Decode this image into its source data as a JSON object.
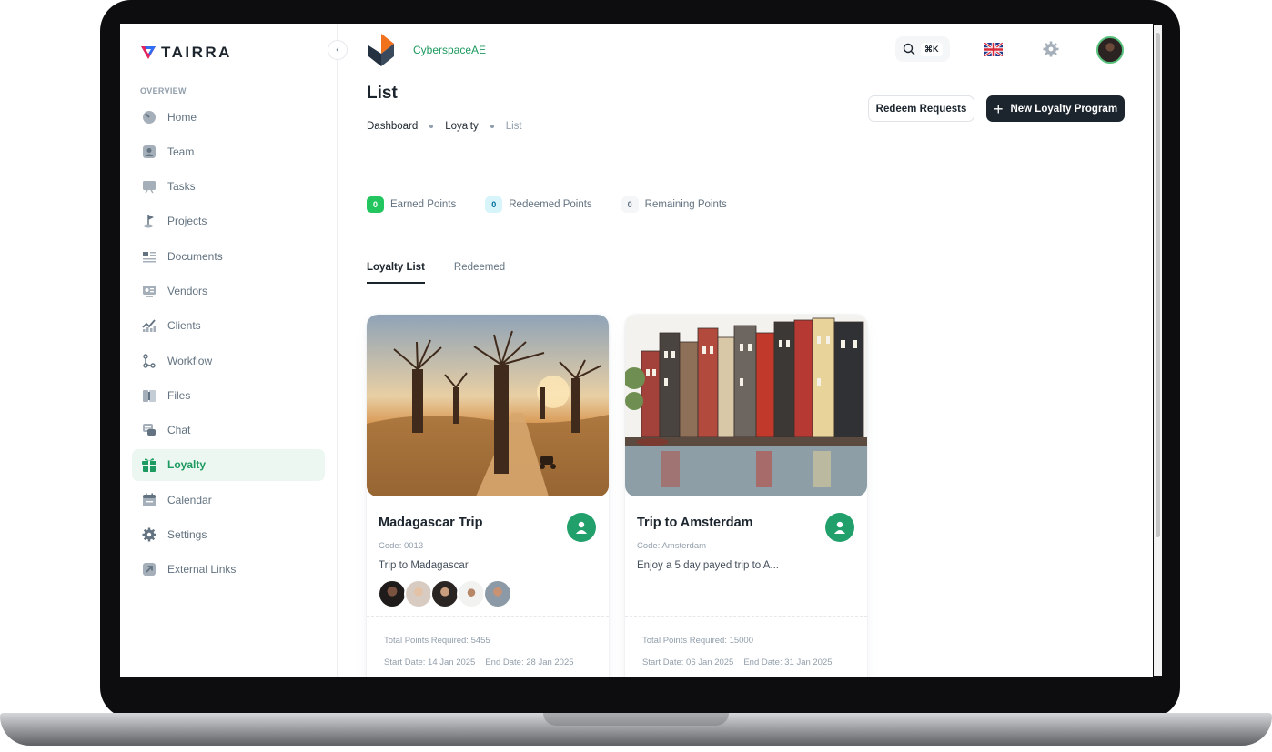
{
  "brand": {
    "name": "TAIRRA"
  },
  "sidebar": {
    "section_title": "OVERVIEW",
    "items": [
      {
        "label": "Home",
        "icon": "dashboard-gauge-icon"
      },
      {
        "label": "Team",
        "icon": "user-badge-icon"
      },
      {
        "label": "Tasks",
        "icon": "board-icon"
      },
      {
        "label": "Projects",
        "icon": "flag-icon"
      },
      {
        "label": "Documents",
        "icon": "document-icon"
      },
      {
        "label": "Vendors",
        "icon": "vendor-card-icon"
      },
      {
        "label": "Clients",
        "icon": "chart-up-icon"
      },
      {
        "label": "Workflow",
        "icon": "workflow-icon"
      },
      {
        "label": "Files",
        "icon": "folder-icon"
      },
      {
        "label": "Chat",
        "icon": "chat-icon"
      },
      {
        "label": "Loyalty",
        "icon": "gift-icon",
        "active": true
      },
      {
        "label": "Calendar",
        "icon": "calendar-icon"
      },
      {
        "label": "Settings",
        "icon": "gear-icon"
      },
      {
        "label": "External Links",
        "icon": "external-link-icon"
      }
    ]
  },
  "header": {
    "org_name": "CyberspaceAE",
    "search_shortcut": "⌘K",
    "language": "English (UK)"
  },
  "page": {
    "title": "List",
    "breadcrumbs": [
      "Dashboard",
      "Loyalty",
      "List"
    ],
    "redeem_button": "Redeem Requests",
    "new_button": "New Loyalty Program"
  },
  "stats": [
    {
      "value": "0",
      "label": "Earned Points",
      "color": "#22c55e"
    },
    {
      "value": "0",
      "label": "Redeemed Points",
      "color": "#d6f4f9"
    },
    {
      "value": "0",
      "label": "Remaining Points",
      "color": "#f4f6f8"
    }
  ],
  "tabs": [
    {
      "label": "Loyalty List",
      "active": true
    },
    {
      "label": "Redeemed",
      "active": false
    }
  ],
  "cards": [
    {
      "title": "Madagascar Trip",
      "code": "Code: 0013",
      "description": "Trip to Madagascar",
      "total_points": "Total Points Required: 5455",
      "start_date": "Start Date: 14 Jan 2025",
      "end_date": "End Date: 28 Jan 2025"
    },
    {
      "title": "Trip to Amsterdam",
      "code": "Code: Amsterdam",
      "description": "Enjoy a 5 day payed trip to A...",
      "total_points": "Total Points Required: 15000",
      "start_date": "Start Date: 06 Jan 2025",
      "end_date": "End Date: 31 Jan 2025"
    }
  ],
  "colors": {
    "accent": "#1d9a5f",
    "dark": "#1c252e",
    "active_bg": "#ecf7f1"
  }
}
